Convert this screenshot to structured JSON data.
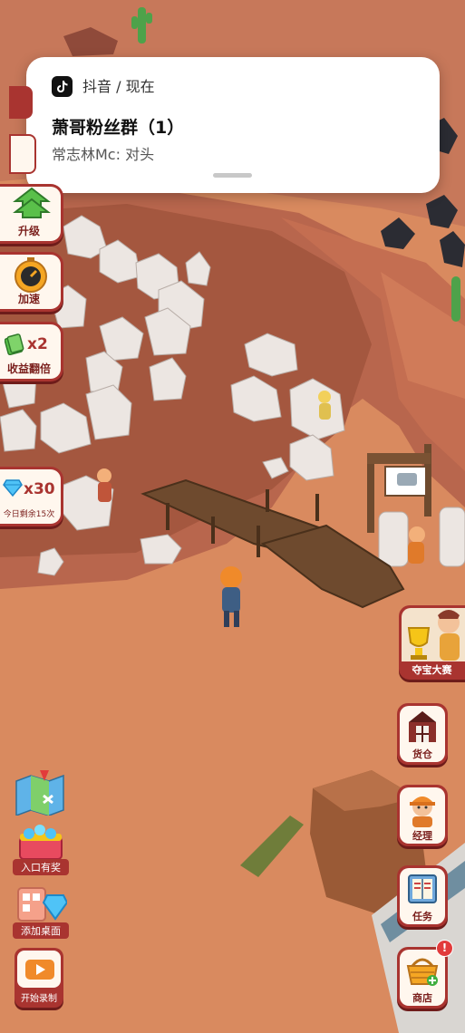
{
  "notification": {
    "source": "抖音 / 现在",
    "title": "萧哥粉丝群（1）",
    "message": "常志林Mc: 对头"
  },
  "left_buttons": {
    "upgrade_label": "升级",
    "speed_label": "加速",
    "income_multiplier": "x2",
    "income_label": "收益翻倍",
    "diamond_multiplier": "x30",
    "diamond_remaining": "今日剩余15次"
  },
  "right_buttons": {
    "treasure_label": "夺宝大赛",
    "warehouse_label": "货仓",
    "manager_label": "经理",
    "task_label": "任务",
    "shop_label": "商店",
    "shop_alert": "!"
  },
  "bottom_left": {
    "entry_reward_label": "入口有奖",
    "add_desktop_label": "添加桌面",
    "record_label": "开始录制"
  },
  "colors": {
    "accent_red": "#a93430",
    "ground": "#d9895f",
    "pit": "#a45a45"
  },
  "icons": [
    "map-icon",
    "gift-gems-icon",
    "add-desktop-icon",
    "record-video-icon",
    "tiktok-icon",
    "upgrade-arrow-icon",
    "stopwatch-icon",
    "cash-icon",
    "diamond-icon",
    "barn-icon",
    "worker-icon",
    "task-book-icon",
    "basket-icon",
    "trophy-icon"
  ]
}
